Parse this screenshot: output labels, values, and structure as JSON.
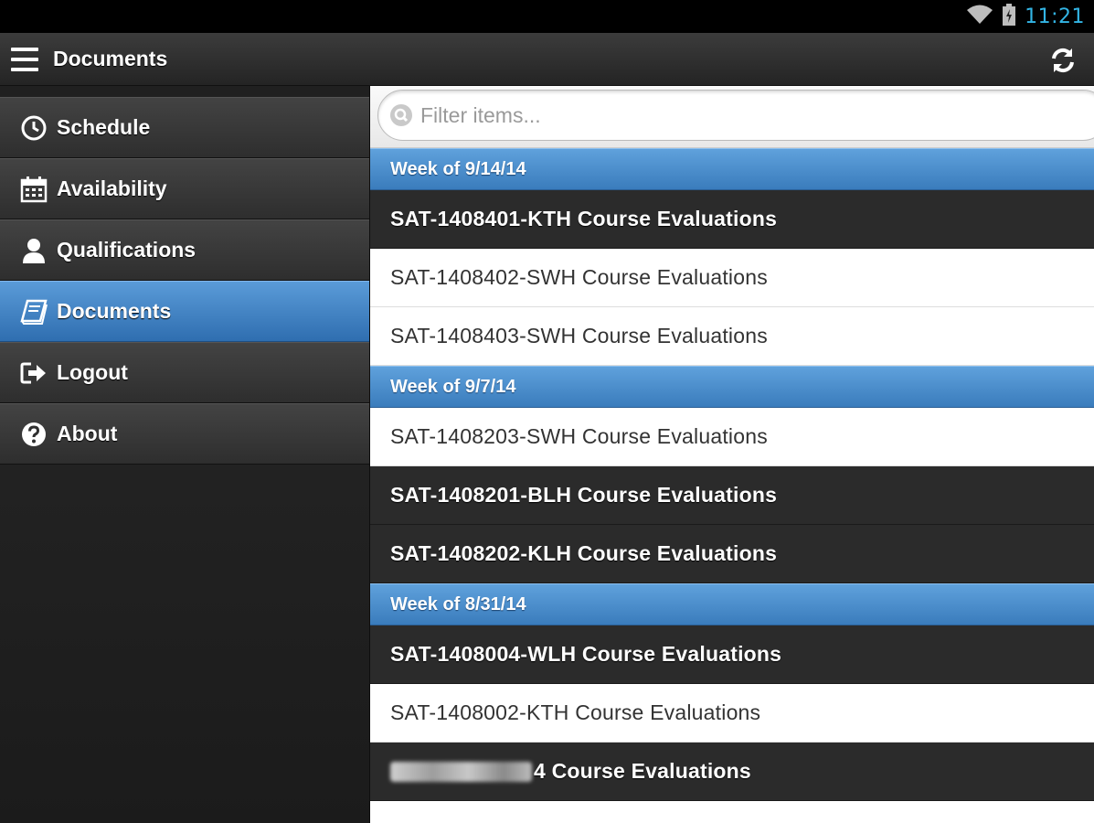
{
  "status_bar": {
    "time": "11:21",
    "wifi_icon": "wifi-icon",
    "battery_icon": "battery-icon"
  },
  "action_bar": {
    "title": "Documents",
    "menu_icon": "hamburger-icon",
    "refresh_icon": "refresh-icon"
  },
  "sidebar": {
    "items": [
      {
        "label": "Schedule",
        "icon": "clock-icon"
      },
      {
        "label": "Availability",
        "icon": "calendar-icon"
      },
      {
        "label": "Qualifications",
        "icon": "person-icon"
      },
      {
        "label": "Documents",
        "icon": "book-icon",
        "active": true
      },
      {
        "label": "Logout",
        "icon": "logout-icon"
      },
      {
        "label": "About",
        "icon": "help-icon"
      }
    ]
  },
  "main": {
    "filter": {
      "placeholder": "Filter items...",
      "value": ""
    },
    "groups": [
      {
        "header": "Week of 9/14/14",
        "items": [
          "SAT-1408401-KTH Course Evaluations",
          "SAT-1408402-SWH Course Evaluations",
          "SAT-1408403-SWH Course Evaluations"
        ]
      },
      {
        "header": "Week of 9/7/14",
        "items": [
          "SAT-1408203-SWH Course Evaluations",
          "SAT-1408201-BLH Course Evaluations",
          "SAT-1408202-KLH Course Evaluations"
        ]
      },
      {
        "header": "Week of 8/31/14",
        "items": [
          "SAT-1408004-WLH Course Evaluations",
          "SAT-1408002-KTH Course Evaluations",
          "4 Course Evaluations"
        ]
      }
    ]
  },
  "colors": {
    "accent": "#33b5e5",
    "active_blue": "#3a7cbc",
    "dark_row": "#2b2b2b"
  }
}
